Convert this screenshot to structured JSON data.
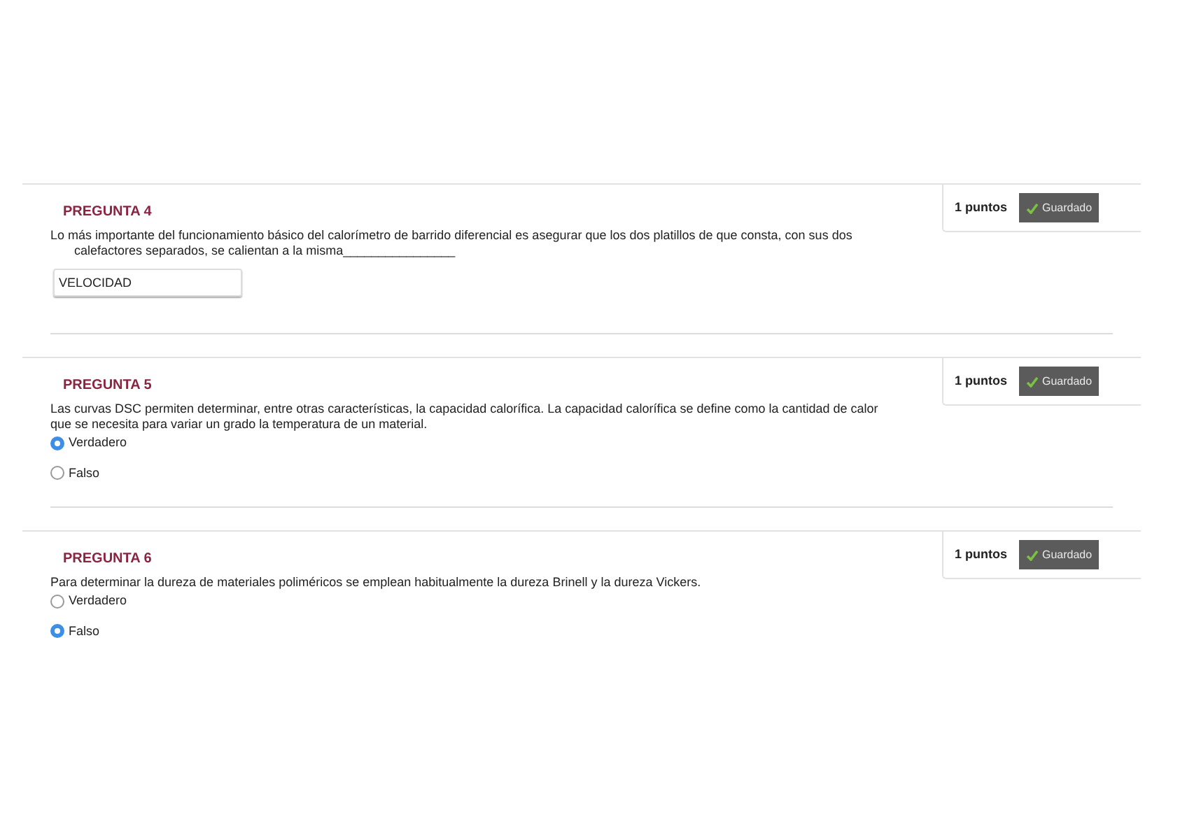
{
  "questions": [
    {
      "title": "PREGUNTA 4",
      "points": "1 puntos",
      "status": "Guardado",
      "text": "Lo más importante del funcionamiento básico del calorímetro de barrido diferencial es asegurar que los dos platillos de que consta, con sus dos calefactores separados, se calientan a la misma________________",
      "kind": "fill_blank",
      "answer": "VELOCIDAD"
    },
    {
      "title": "PREGUNTA 5",
      "points": "1 puntos",
      "status": "Guardado",
      "text": "Las curvas DSC permiten determinar, entre otras características, la capacidad calorífica. La capacidad calorífica se define como la cantidad de calor que se necesita para variar un grado la temperatura de un material.",
      "kind": "true_false",
      "options": [
        {
          "label": "Verdadero",
          "selected": true
        },
        {
          "label": "Falso",
          "selected": false
        }
      ]
    },
    {
      "title": "PREGUNTA 6",
      "points": "1 puntos",
      "status": "Guardado",
      "text": "Para determinar la dureza de materiales poliméricos se emplean habitualmente la dureza Brinell y la dureza Vickers.",
      "kind": "true_false",
      "options": [
        {
          "label": "Verdadero",
          "selected": false
        },
        {
          "label": "Falso",
          "selected": true
        }
      ]
    }
  ]
}
